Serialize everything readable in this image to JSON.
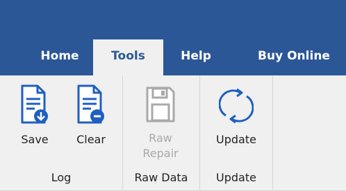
{
  "colors": {
    "title_bar": "#2b5797",
    "ribbon_bg": "#f0f0f0",
    "icon_blue": "#1f5fbf",
    "disabled_gray": "#a9a9a9"
  },
  "tabs": [
    {
      "label": "Home",
      "active": false
    },
    {
      "label": "Tools",
      "active": true
    },
    {
      "label": "Help",
      "active": false
    },
    {
      "label": "Buy Online",
      "active": false
    }
  ],
  "ribbon": {
    "groups": [
      {
        "label": "Log",
        "buttons": [
          {
            "label": "Save",
            "icon": "document-save-icon",
            "enabled": true
          },
          {
            "label": "Clear",
            "icon": "document-clear-icon",
            "enabled": true
          }
        ]
      },
      {
        "label": "Raw Data",
        "buttons": [
          {
            "label_line1": "Raw",
            "label_line2": "Repair",
            "icon": "floppy-disk-icon",
            "enabled": false
          }
        ]
      },
      {
        "label": "Update",
        "buttons": [
          {
            "label": "Update",
            "icon": "refresh-icon",
            "enabled": true
          }
        ]
      }
    ]
  }
}
